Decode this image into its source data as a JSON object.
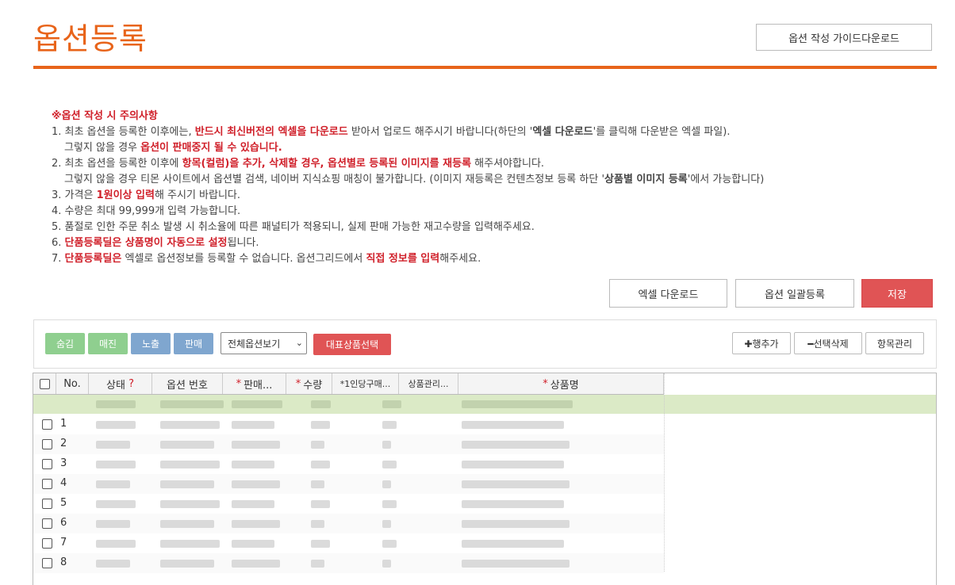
{
  "header": {
    "title": "옵션등록",
    "guide_button": "옵션 작성 가이드다운로드"
  },
  "notes": {
    "heading": "※옵션 작성 시 주의사항",
    "l1a": "1. 최초 옵션을 등록한 이후에는, ",
    "l1b": "반드시 최신버전의 엑셀을 다운로드",
    "l1c": " 받아서 업로드 해주시기 바랍니다(하단의 '",
    "l1d": "엑셀 다운로드",
    "l1e": "'를 클릭해 다운받은 엑셀 파일).",
    "l1f": "그렇지 않을 경우 ",
    "l1g": "옵션이 판매중지 될 수 있습니다.",
    "l2a": "2. 최초 옵션을 등록한 이후에 ",
    "l2b": "항목(컬럼)을 추가, 삭제할 경우, 옵션별로 등록된 이미지를 재등록",
    "l2c": " 해주셔야합니다.",
    "l2d": "그렇지 않을 경우 티몬 사이트에서 옵션별 검색, 네이버 지식쇼핑 매칭이 불가합니다. (이미지 재등록은 컨텐츠정보 등록 하단 '",
    "l2e": "상품별 이미지 등록",
    "l2f": "'에서 가능합니다)",
    "l3a": "3. 가격은 ",
    "l3b": "1원이상 입력",
    "l3c": "해 주시기 바랍니다.",
    "l4": "4. 수량은 최대 99,999개 입력 가능합니다.",
    "l5": "5. 품절로 인한 주문 취소 발생 시 취소율에 따른 패널티가 적용되니, 실제 판매 가능한 재고수량을 입력해주세요.",
    "l6a": "6. ",
    "l6b": "단품등록딜은 상품명이 자동으로 설정",
    "l6c": "됩니다.",
    "l7a": "7. ",
    "l7b": "단품등록딜은",
    "l7c": " 엑셀로 옵션정보를 등록할 수 없습니다. 옵션그리드에서 ",
    "l7d": "직접 정보를 입력",
    "l7e": "해주세요."
  },
  "actions": {
    "excel_download": "엑셀 다운로드",
    "bulk_register": "옵션 일괄등록",
    "save": "저장"
  },
  "toolbar": {
    "hide": "숨김",
    "soldout": "매진",
    "expose": "노출",
    "sell": "판매",
    "view_select": "전체옵션보기",
    "rep_product": "대표상품선택",
    "add_row": "✚행추가",
    "delete_selected": "━선택삭제",
    "manage_columns": "항목관리"
  },
  "colors": {
    "hide": "#8fcf8f",
    "soldout": "#8fcf8f",
    "expose": "#7fa6cf",
    "sell": "#7fa6cf",
    "accent": "#e8641a"
  },
  "grid": {
    "headers": {
      "no": "No.",
      "status": "상태",
      "status_help": "?",
      "option_no": "옵션 번호",
      "price": "판매...",
      "qty": "수량",
      "limit": "*1인당구매...",
      "manage": "상품관리...",
      "name": "상품명"
    },
    "rows": [
      "1",
      "2",
      "3",
      "4",
      "5",
      "6",
      "7",
      "8"
    ]
  }
}
